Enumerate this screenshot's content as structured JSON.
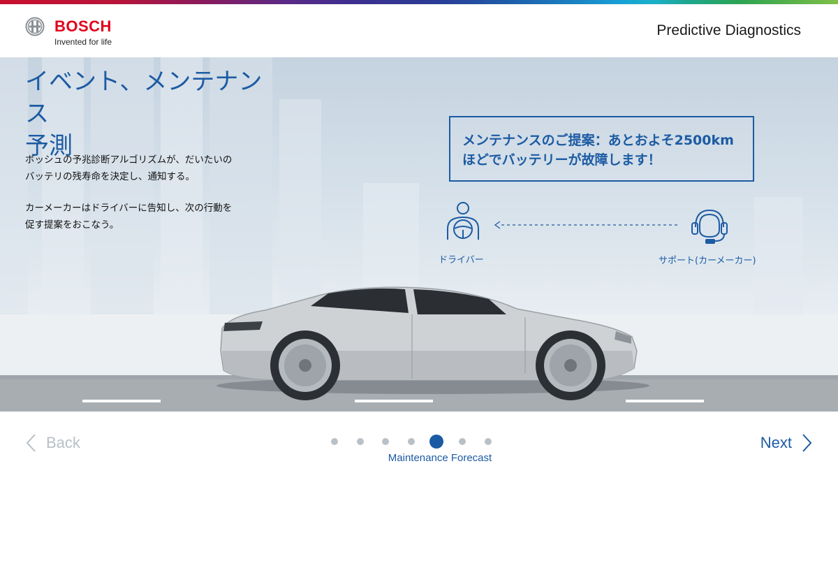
{
  "brand": {
    "name": "BOSCH",
    "tagline": "Invented for life",
    "brand_color": "#e2001a"
  },
  "header": {
    "title": "Predictive Diagnostics"
  },
  "slide": {
    "heading_line1": "イベント、メンテナンス",
    "heading_line2": "予測",
    "paragraph1_line1": "ボッシュの予兆診断アルゴリズムが、だいたいの",
    "paragraph1_line2": "バッテリの残寿命を決定し、通知する。",
    "paragraph2_line1": "カーメーカーはドライバーに告知し、次の行動を",
    "paragraph2_line2": "促す提案をおこなう。",
    "alert_line1": "メンテナンスのご提案：あとおよそ2500km",
    "alert_line2": "ほどでバッテリーが故障します！",
    "driver_label": "ドライバー",
    "support_label": "サポート(カーメーカー)",
    "driver_icon": "driver-steering-wheel-icon",
    "support_icon": "headset-support-icon",
    "accent_color": "#1c5ba3"
  },
  "navigation": {
    "back_label": "Back",
    "next_label": "Next",
    "step_label": "Maintenance Forecast",
    "total_steps": 7,
    "current_step": 5
  }
}
